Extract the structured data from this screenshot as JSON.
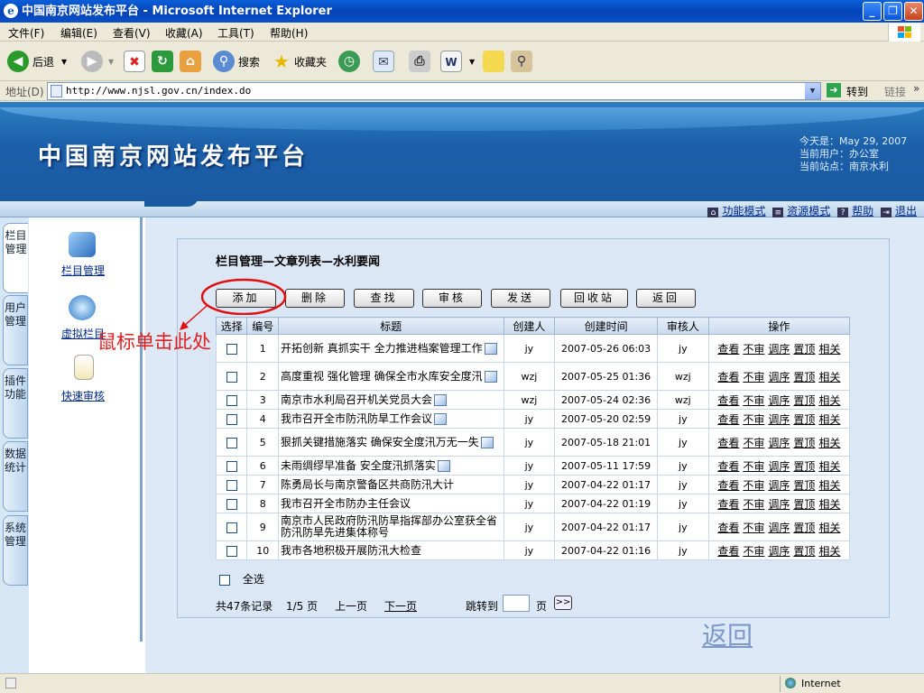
{
  "window": {
    "title": "中国南京网站发布平台 - Microsoft Internet Explorer",
    "buttons": [
      "_",
      "❐",
      "✕"
    ]
  },
  "menu": [
    "文件(F)",
    "编辑(E)",
    "查看(V)",
    "收藏(A)",
    "工具(T)",
    "帮助(H)"
  ],
  "toolbar": {
    "back": "后退",
    "search": "搜索",
    "favorites": "收藏夹"
  },
  "address": {
    "label": "地址(D)",
    "url": "http://www.njsl.gov.cn/index.do",
    "go": "转到",
    "links": "链接"
  },
  "site": {
    "title": "中国南京网站发布平台",
    "today": "今天是：May 29, 2007",
    "user": "当前用户：办公室",
    "station": "当前站点：南京水利"
  },
  "nav": [
    "功能模式",
    "资源模式",
    "帮助",
    "退出"
  ],
  "sidetabs": [
    "栏目管理",
    "用户管理",
    "插件功能",
    "数据统计",
    "系统管理"
  ],
  "sidepanel": [
    "栏目管理",
    "虚拟栏目",
    "快速审核"
  ],
  "panel": {
    "title": "栏目管理—文章列表—水利要闻",
    "buttons": [
      "添加",
      "删除",
      "查找",
      "审核",
      "发送",
      "回收站",
      "返回"
    ]
  },
  "chart_data": {
    "type": "table",
    "columns": [
      "选择",
      "编号",
      "标题",
      "创建人",
      "创建时间",
      "审核人",
      "操作"
    ],
    "rows": [
      {
        "no": "1",
        "title": "开拓创新 真抓实干 全力推进档案管理工作",
        "img": true,
        "creator": "jy",
        "time": "2007-05-26 06:03",
        "auditor": "jy"
      },
      {
        "no": "2",
        "title": "高度重视 强化管理 确保全市水库安全度汛",
        "img": true,
        "creator": "wzj",
        "time": "2007-05-25 01:36",
        "auditor": "wzj"
      },
      {
        "no": "3",
        "title": "南京市水利局召开机关党员大会",
        "img": true,
        "creator": "wzj",
        "time": "2007-05-24 02:36",
        "auditor": "wzj"
      },
      {
        "no": "4",
        "title": "我市召开全市防汛防旱工作会议",
        "img": true,
        "creator": "jy",
        "time": "2007-05-20 02:59",
        "auditor": "jy"
      },
      {
        "no": "5",
        "title": "狠抓关键措施落实 确保安全度汛万无一失",
        "img": true,
        "creator": "jy",
        "time": "2007-05-18 21:01",
        "auditor": "jy"
      },
      {
        "no": "6",
        "title": "未雨绸缪早准备 安全度汛抓落实",
        "img": true,
        "creator": "jy",
        "time": "2007-05-11 17:59",
        "auditor": "jy"
      },
      {
        "no": "7",
        "title": "陈勇局长与南京警备区共商防汛大计",
        "img": false,
        "creator": "jy",
        "time": "2007-04-22 01:17",
        "auditor": "jy"
      },
      {
        "no": "8",
        "title": "我市召开全市防办主任会议",
        "img": false,
        "creator": "jy",
        "time": "2007-04-22 01:19",
        "auditor": "jy"
      },
      {
        "no": "9",
        "title": "南京市人民政府防汛防旱指挥部办公室获全省防汛防旱先进集体称号",
        "img": false,
        "creator": "jy",
        "time": "2007-04-22 01:17",
        "auditor": "jy"
      },
      {
        "no": "10",
        "title": "我市各地积极开展防汛大检查",
        "img": false,
        "creator": "jy",
        "time": "2007-04-22 01:16",
        "auditor": "jy"
      }
    ],
    "ops": [
      "查看",
      "不审",
      "调序",
      "置顶",
      "相关"
    ]
  },
  "selectall": "全选",
  "pager": {
    "total": "共47条记录",
    "page": "1/5 页",
    "prev": "上一页",
    "next": "下一页",
    "jump": "跳转到",
    "unit": "页",
    "go": ">>"
  },
  "back_link": "返回",
  "annotation": "鼠标单击此处",
  "statusbar": {
    "zone": "Internet"
  }
}
